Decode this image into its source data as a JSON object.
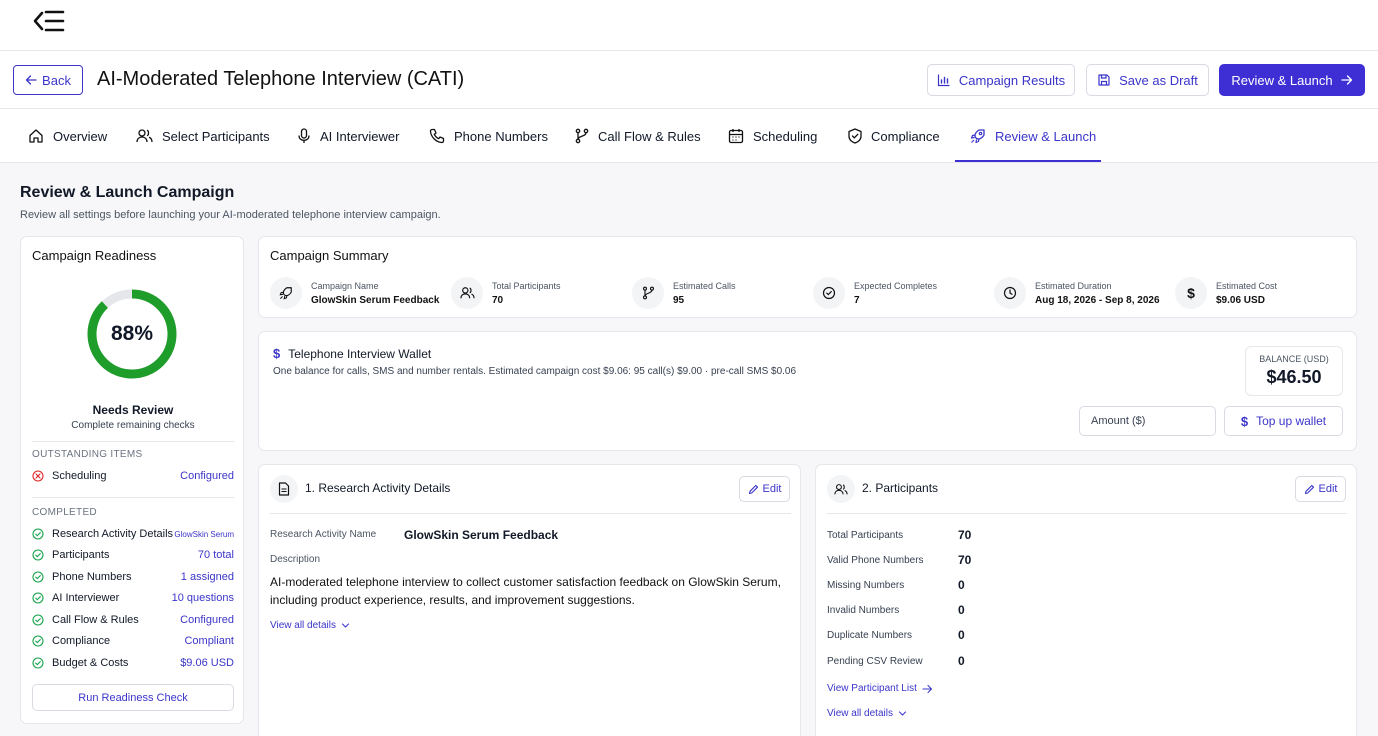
{
  "header": {
    "back_label": "Back",
    "title": "AI-Moderated Telephone Interview (CATI)",
    "campaign_results_label": "Campaign Results",
    "save_draft_label": "Save as Draft",
    "review_launch_label": "Review & Launch"
  },
  "tabs": [
    {
      "label": "Overview",
      "icon": "home-icon"
    },
    {
      "label": "Select Participants",
      "icon": "users-icon"
    },
    {
      "label": "AI Interviewer",
      "icon": "microphone-icon"
    },
    {
      "label": "Phone Numbers",
      "icon": "phone-icon"
    },
    {
      "label": "Call Flow & Rules",
      "icon": "branch-icon"
    },
    {
      "label": "Scheduling",
      "icon": "calendar-icon"
    },
    {
      "label": "Compliance",
      "icon": "shield-check-icon"
    },
    {
      "label": "Review & Launch",
      "icon": "rocket-icon",
      "active": true
    }
  ],
  "section": {
    "title": "Review & Launch Campaign",
    "subtitle": "Review all settings before launching your AI-moderated telephone interview campaign."
  },
  "readiness": {
    "title": "Campaign Readiness",
    "percent_label": "88%",
    "percent": 88,
    "status": "Needs Review",
    "status_sub": "Complete remaining checks",
    "outstanding_label": "OUTSTANDING ITEMS",
    "outstanding": [
      {
        "label": "Scheduling",
        "value": "Configured"
      }
    ],
    "completed_label": "COMPLETED",
    "completed": [
      {
        "label": "Research Activity Details",
        "value": "GlowSkin Serum"
      },
      {
        "label": "Participants",
        "value": "70 total"
      },
      {
        "label": "Phone Numbers",
        "value": "1 assigned"
      },
      {
        "label": "AI Interviewer",
        "value": "10 questions"
      },
      {
        "label": "Call Flow & Rules",
        "value": "Configured"
      },
      {
        "label": "Compliance",
        "value": "Compliant"
      },
      {
        "label": "Budget & Costs",
        "value": "$9.06 USD"
      }
    ],
    "run_check_label": "Run Readiness Check",
    "colors": {
      "ring": "#1f9d2a",
      "ring_track": "#e5e7eb",
      "ok": "#16a34a",
      "error": "#dc2626"
    }
  },
  "summary": {
    "title": "Campaign Summary",
    "items": [
      {
        "label": "Campaign Name",
        "value": "GlowSkin Serum Feedback",
        "icon": "rocket-icon"
      },
      {
        "label": "Total Participants",
        "value": "70",
        "icon": "users-icon"
      },
      {
        "label": "Estimated Calls",
        "value": "95",
        "icon": "branch-icon"
      },
      {
        "label": "Expected Completes",
        "value": "7",
        "icon": "check-circle-icon"
      },
      {
        "label": "Estimated Duration",
        "value": "Aug 18, 2026 - Sep 8, 2026",
        "icon": "clock-icon"
      },
      {
        "label": "Estimated Cost",
        "value": "$9.06 USD",
        "icon": "dollar-icon"
      }
    ]
  },
  "wallet": {
    "title": "Telephone Interview Wallet",
    "subtitle": "One balance for calls, SMS and number rentals. Estimated campaign cost $9.06: 95 call(s) $9.00 · pre-call SMS $0.06",
    "balance_label": "BALANCE (USD)",
    "balance_value": "$46.50",
    "amount_placeholder": "Amount ($)",
    "topup_label": "Top up wallet"
  },
  "research": {
    "title": "1. Research Activity Details",
    "edit_label": "Edit",
    "name_label": "Research Activity Name",
    "name_value": "GlowSkin Serum Feedback",
    "description_label": "Description",
    "description": "AI-moderated telephone interview to collect customer satisfaction feedback on GlowSkin Serum, including product experience, results, and improvement suggestions.",
    "view_all_label": "View all details"
  },
  "participants": {
    "title": "2. Participants",
    "edit_label": "Edit",
    "rows": [
      {
        "label": "Total Participants",
        "value": "70"
      },
      {
        "label": "Valid Phone Numbers",
        "value": "70"
      },
      {
        "label": "Missing Numbers",
        "value": "0"
      },
      {
        "label": "Invalid Numbers",
        "value": "0"
      },
      {
        "label": "Duplicate Numbers",
        "value": "0"
      },
      {
        "label": "Pending CSV Review",
        "value": "0"
      }
    ],
    "view_list_label": "View Participant List",
    "view_all_label": "View all details"
  },
  "theme": {
    "accent": "#3d2fd4",
    "link": "#3b35c9"
  }
}
